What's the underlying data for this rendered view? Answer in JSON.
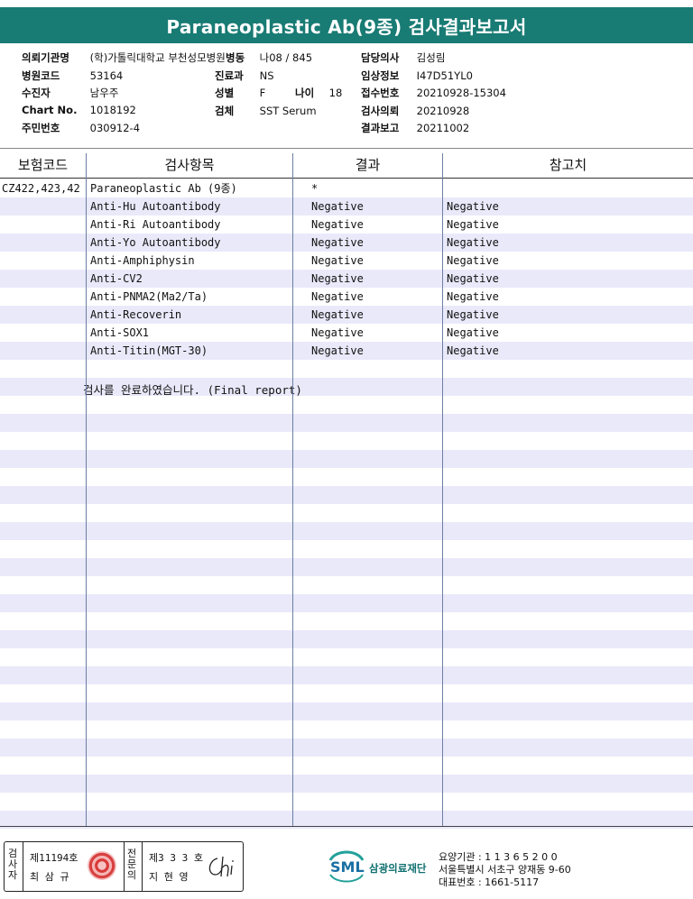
{
  "title": "Paraneoplastic Ab(9종) 검사결과보고서",
  "meta": {
    "col1": [
      {
        "label": "의뢰기관명",
        "value": "(학)가톨릭대학교 부천성모병원"
      },
      {
        "label": "병원코드",
        "value": "53164"
      },
      {
        "label": "수진자",
        "value": "남우주"
      },
      {
        "label": "Chart No.",
        "value": "1018192"
      },
      {
        "label": "주민번호",
        "value": "030912-4"
      }
    ],
    "ward": {
      "label": "병동",
      "value": "나08 / 845"
    },
    "dept": {
      "label": "진료과",
      "value": "NS"
    },
    "sex": {
      "label": "성별",
      "value": "F"
    },
    "age": {
      "label": "나이",
      "value": "18"
    },
    "specimen": {
      "label": "검체",
      "value": "SST Serum"
    },
    "col3": [
      {
        "label": "담당의사",
        "value": "김성림"
      },
      {
        "label": "임상정보",
        "value": "I47D51YL0"
      },
      {
        "label": "접수번호",
        "value": "20210928-15304"
      },
      {
        "label": "검사의뢰",
        "value": "20210928"
      },
      {
        "label": "결과보고",
        "value": "20211002"
      }
    ]
  },
  "table": {
    "headers": {
      "code": "보험코드",
      "item": "검사항목",
      "result": "결과",
      "ref": "참고치"
    },
    "rows": [
      {
        "code": "CZ422,423,42",
        "item": "Paraneoplastic Ab (9종)",
        "result": "*",
        "ref": ""
      },
      {
        "code": "",
        "item": "Anti-Hu Autoantibody",
        "result": "Negative",
        "ref": "Negative"
      },
      {
        "code": "",
        "item": "Anti-Ri Autoantibody",
        "result": "Negative",
        "ref": "Negative"
      },
      {
        "code": "",
        "item": "Anti-Yo Autoantibody",
        "result": "Negative",
        "ref": "Negative"
      },
      {
        "code": "",
        "item": "Anti-Amphiphysin",
        "result": "Negative",
        "ref": "Negative"
      },
      {
        "code": "",
        "item": "Anti-CV2",
        "result": "Negative",
        "ref": "Negative"
      },
      {
        "code": "",
        "item": "Anti-PNMA2(Ma2/Ta)",
        "result": "Negative",
        "ref": "Negative"
      },
      {
        "code": "",
        "item": "Anti-Recoverin",
        "result": "Negative",
        "ref": "Negative"
      },
      {
        "code": "",
        "item": "Anti-SOX1",
        "result": "Negative",
        "ref": "Negative"
      },
      {
        "code": "",
        "item": "Anti-Titin(MGT-30)",
        "result": "Negative",
        "ref": "Negative"
      }
    ],
    "note": "검사를  완료하였습니다. (Final report)"
  },
  "footer": {
    "examiner_label": "검사자",
    "examiner_no": "제11194호",
    "examiner_name": "최 삼 규",
    "specialist_label": "전문의",
    "specialist_no": "제3 3 3 호",
    "specialist_name": "지 현 영",
    "logo_text": "SML",
    "org_name": "삼광의료재단",
    "info": [
      "요양기관 : 1 1 3 6 5 2 0 0",
      "서울특별시 서초구 양재동 9-60",
      "대표번호 : 1661-5117"
    ],
    "colors": {
      "brand": "#187b74",
      "stripe": "#e9e9fa",
      "seal": "#d93a3a"
    }
  }
}
